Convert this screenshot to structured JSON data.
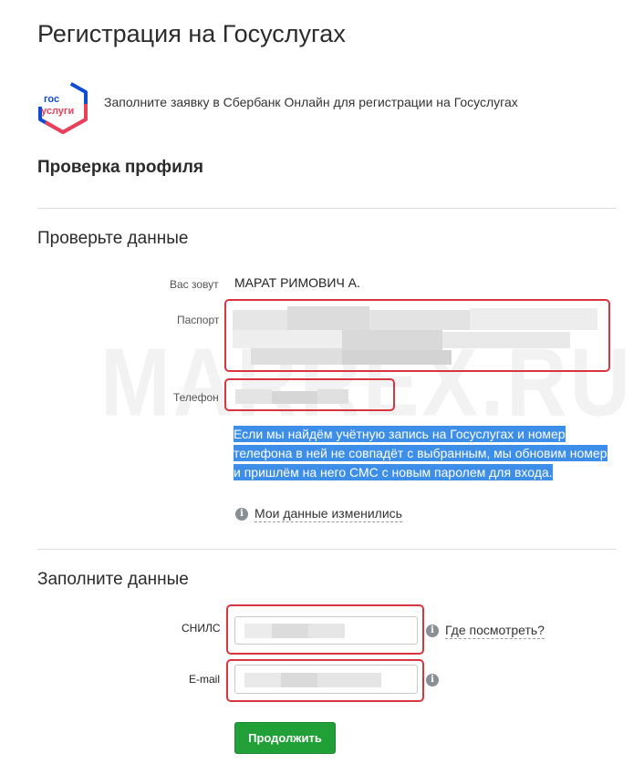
{
  "header": {
    "title": "Регистрация на Госуслугах",
    "logo_text_top": "гос",
    "logo_text_bottom": "услуги",
    "subtitle": "Заполните заявку в Сбербанк Онлайн для регистрации на Госуслугах"
  },
  "profile_check": {
    "heading": "Проверка профиля",
    "verify_heading": "Проверьте данные",
    "name_label": "Вас зовут",
    "name_value": "МАРАТ РИМОВИЧ А.",
    "passport_label": "Паспорт",
    "phone_label": "Телефон",
    "info_text": "Если мы найдём учётную запись на Госуслугах и номер телефона в ней не совпадёт с выбранным, мы обновим номер и пришлём на него СМС с новым паролем для входа.",
    "changed_link": "Мои данные изменились"
  },
  "fill_form": {
    "heading": "Заполните данные",
    "snils_label": "СНИЛС",
    "snils_help_link": "Где посмотреть?",
    "email_label": "E-mail",
    "continue_label": "Продолжить"
  },
  "watermark": "MARREX.RU",
  "colors": {
    "highlight_red": "#d9353f",
    "primary_green": "#21a038",
    "selection_blue": "#3d8ee8",
    "logo_blue": "#0d4cd3",
    "logo_red": "#ee3f58"
  }
}
